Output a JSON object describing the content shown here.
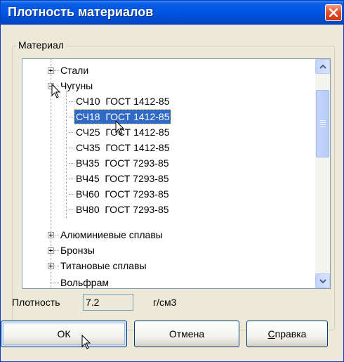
{
  "window": {
    "title": "Плотность материалов"
  },
  "group": {
    "label": "Материал"
  },
  "tree": {
    "items": [
      {
        "label": "Стали",
        "expander": "plus"
      },
      {
        "label": "Чугуны",
        "expander": "minus"
      },
      {
        "label": "СЧ10  ГОСТ 1412-85"
      },
      {
        "label": "СЧ18  ГОСТ 1412-85",
        "selected": true
      },
      {
        "label": "СЧ25  ГОСТ 1412-85"
      },
      {
        "label": "СЧ35  ГОСТ 1412-85"
      },
      {
        "label": "ВЧ35  ГОСТ 7293-85"
      },
      {
        "label": "ВЧ45  ГОСТ 7293-85"
      },
      {
        "label": "ВЧ60  ГОСТ 7293-85"
      },
      {
        "label": "ВЧ80  ГОСТ 7293-85"
      },
      {
        "label": "Алюминиевые сплавы",
        "expander": "plus"
      },
      {
        "label": "Бронзы",
        "expander": "plus"
      },
      {
        "label": "Титановые сплавы",
        "expander": "plus"
      },
      {
        "label": "Вольфрам"
      }
    ]
  },
  "density": {
    "label": "Плотность",
    "value": "7.2",
    "unit": "г/см3"
  },
  "buttons": {
    "ok": "ОК",
    "cancel": "Отмена",
    "help_underlined": "С",
    "help_rest": "правка"
  },
  "colors": {
    "title_bar": "#0054e3",
    "selection": "#316ac5",
    "dialog_bg": "#ece9d8",
    "close_button": "#e0522c"
  },
  "icons": [
    "close-icon",
    "arrow-up-icon",
    "arrow-down-icon",
    "plus-icon",
    "minus-icon",
    "pointer-cursor-icon"
  ]
}
